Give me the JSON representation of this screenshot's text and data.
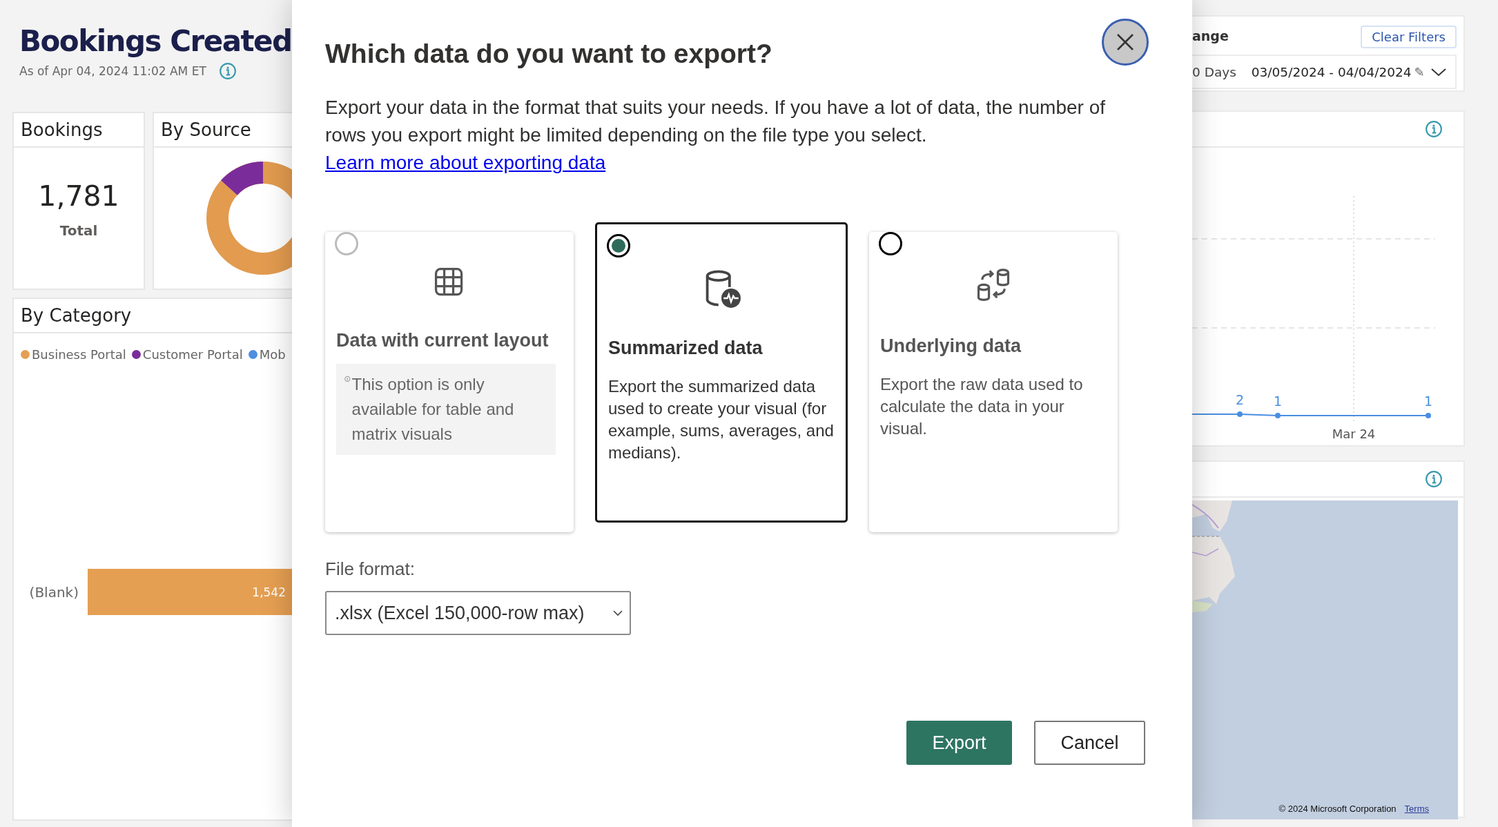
{
  "dashboard": {
    "title": "Bookings Created",
    "subtitle": "As of Apr 04, 2024 11:02 AM ET",
    "kpi_card": {
      "title": "Bookings",
      "value": "1,781",
      "caption": "Total"
    },
    "source_card": {
      "title": "By Source"
    },
    "category_card": {
      "title": "By Category",
      "legend": [
        {
          "label": "Business Portal",
          "color": "#e59f52"
        },
        {
          "label": "Customer Portal",
          "color": "#7b2c9b"
        },
        {
          "label": "Mob",
          "color": "#4f8ee0"
        }
      ],
      "bars": [
        {
          "label": "(Blank)",
          "value": "1,542"
        }
      ]
    },
    "filter_panel": {
      "label": "ange",
      "clear_button": "Clear Filters",
      "range": "0 Days",
      "dates": "03/05/2024 - 04/04/2024",
      "edit_glyph": "✎"
    },
    "trend_card": {
      "point_labels": [
        "2",
        "1",
        "1"
      ],
      "x_label": "Mar 24"
    },
    "map_card": {
      "copyright": "© 2024 Microsoft Corporation",
      "terms_link": "Terms"
    }
  },
  "dialog": {
    "title": "Which data do you want to export?",
    "description": "Export your data in the format that suits your needs. If you have a lot of data, the number of rows you export might be limited depending on the file type you select.",
    "link": "Learn more about exporting data",
    "options": [
      {
        "kind": "layout",
        "title": "Data with current layout",
        "text": "This option is only available for table and matrix visuals",
        "selected": false,
        "disabled": true
      },
      {
        "kind": "summarized",
        "title": "Summarized data",
        "text": "Export the summarized data used to create your visual (for example, sums, averages, and medians).",
        "selected": true,
        "disabled": false
      },
      {
        "kind": "underlying",
        "title": "Underlying data",
        "text": "Export the raw data used to calculate the data in your visual.",
        "selected": false,
        "disabled": false
      }
    ],
    "file_format": {
      "label": "File format:",
      "value": ".xlsx (Excel 150,000-row max)"
    },
    "buttons": [
      {
        "kind": "primary",
        "label": "Export"
      },
      {
        "kind": "secondary",
        "label": "Cancel"
      }
    ]
  }
}
